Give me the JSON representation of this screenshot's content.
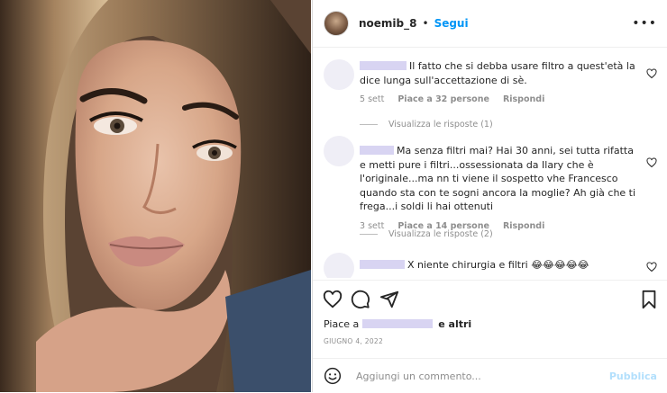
{
  "post": {
    "username": "noemib_8",
    "separator": "•",
    "follow_label": "Segui",
    "more_label": "•••"
  },
  "comments": [
    {
      "text": "Il fatto che si debba usare filtro a quest'età la dice lunga sull'accettazione di sè.",
      "time": "5 sett",
      "likes": "Piace a 32 persone",
      "reply_label": "Rispondi",
      "view_replies": "Visualizza le risposte (1)"
    },
    {
      "text": "Ma senza filtri mai? Hai 30 anni, sei tutta rifatta e metti pure i filtri...ossessionata da Ilary che è l'originale...ma nn ti viene il sospetto vhe Francesco quando sta con te sogni ancora la moglie? Ah già che ti frega...i soldi li hai ottenuti",
      "time": "3 sett",
      "likes": "Piace a 14 persone",
      "reply_label": "Rispondi",
      "view_replies": "Visualizza le risposte (2)"
    },
    {
      "text": "X niente chirurgia e filtri 😂😂😂😂😂"
    }
  ],
  "likes_line": {
    "prefix": "Piace a",
    "suffix": "e altri"
  },
  "post_date": "GIUGNO 4, 2022",
  "add_comment": {
    "placeholder": "Aggiungi un commento...",
    "publish_label": "Pubblica"
  },
  "icons": [
    "heart-icon",
    "comment-icon",
    "share-icon",
    "bookmark-icon",
    "emoji-icon"
  ],
  "colors": {
    "link": "#0095f6",
    "publish_disabled": "#b2dffc",
    "muted": "#8e8e8e",
    "redaction": "#d8d4f2"
  }
}
